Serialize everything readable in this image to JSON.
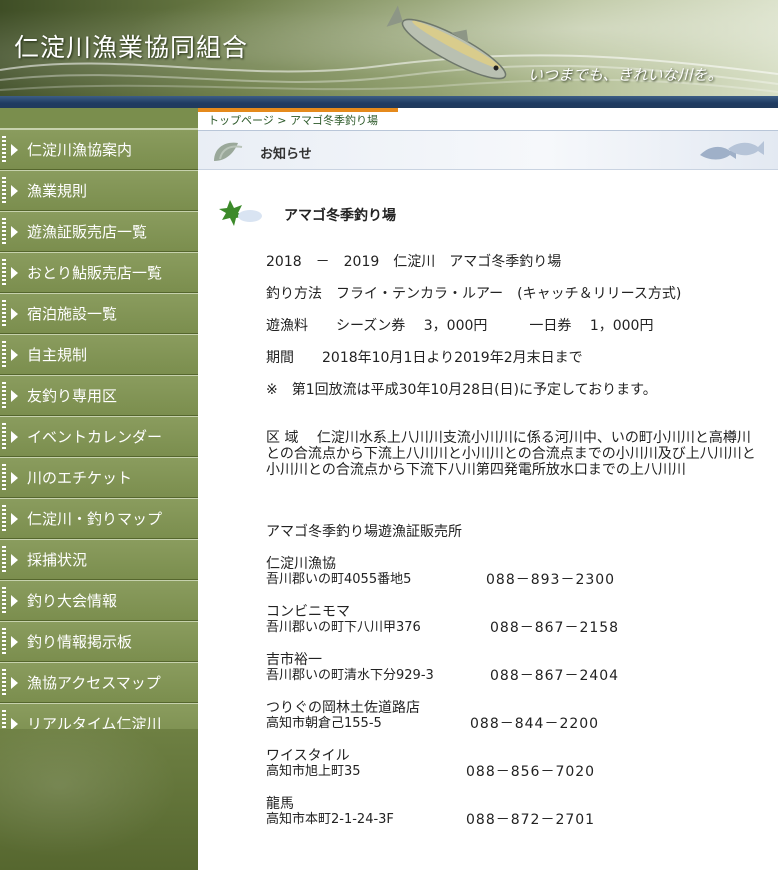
{
  "header": {
    "site_title": "仁淀川漁業協同組合",
    "slogan": "いつまでも、きれいな川を。"
  },
  "breadcrumb": {
    "home": "トップページ",
    "separator": ">",
    "current": "アマゴ冬季釣り場"
  },
  "sidebar": {
    "items": [
      {
        "label": "仁淀川漁協案内"
      },
      {
        "label": "漁業規則"
      },
      {
        "label": "遊漁証販売店一覧"
      },
      {
        "label": "おとり鮎販売店一覧"
      },
      {
        "label": "宿泊施設一覧"
      },
      {
        "label": "自主規制"
      },
      {
        "label": "友釣り専用区"
      },
      {
        "label": "イベントカレンダー"
      },
      {
        "label": "川のエチケット"
      },
      {
        "label": "仁淀川・釣りマップ"
      },
      {
        "label": "採捕状況"
      },
      {
        "label": "釣り大会情報"
      },
      {
        "label": "釣り情報掲示板"
      },
      {
        "label": "漁協アクセスマップ"
      },
      {
        "label": "リアルタイム仁淀川"
      }
    ]
  },
  "section": {
    "title": "お知らせ"
  },
  "article": {
    "title": "アマゴ冬季釣り場",
    "line1": "2018　－　2019　仁淀川　アマゴ冬季釣り場",
    "line2": "釣り方法　フライ・テンカラ・ルアー　(キャッチ＆リリース方式)",
    "line3": "遊漁料　　シーズン券　 3，000円　　　一日券　 1，000円",
    "line4": "期間　　2018年10月1日より2019年2月末日まで",
    "line5": "※　第1回放流は平成30年10月28日(日)に予定しております。",
    "area": "区 域　 仁淀川水系上八川川支流小川川に係る河川中、いの町小川川と高樽川との合流点から下流上八川川と小川川との合流点までの小川川及び上八川川と小川川との合流点から下流下八川第四発電所放水口までの上八川川",
    "shops_heading": "アマゴ冬季釣り場遊漁証販売所",
    "shops": [
      {
        "name": "仁淀川漁協",
        "address": "吾川郡いの町4055番地5",
        "phone": "088－893－2300"
      },
      {
        "name": "コンビニモマ",
        "address": "吾川郡いの町下八川甲376",
        "phone": "088－867－2158"
      },
      {
        "name": "吉市裕一",
        "address": "吾川郡いの町清水下分929-3",
        "phone": "088－867－2404"
      },
      {
        "name": "つりぐの岡林土佐道路店",
        "address": "高知市朝倉己155-5",
        "phone": "088－844－2200"
      },
      {
        "name": "ワイスタイル",
        "address": "高知市旭上町35",
        "phone": "088－856－7020"
      },
      {
        "name": "龍馬",
        "address": "高知市本町2-1-24-3F",
        "phone": "088－872－2701"
      }
    ]
  },
  "colors": {
    "sidebar_green": "#7b8e4e",
    "header_navy": "#1f3b62",
    "breadcrumb_accent": "#e58a1c"
  }
}
